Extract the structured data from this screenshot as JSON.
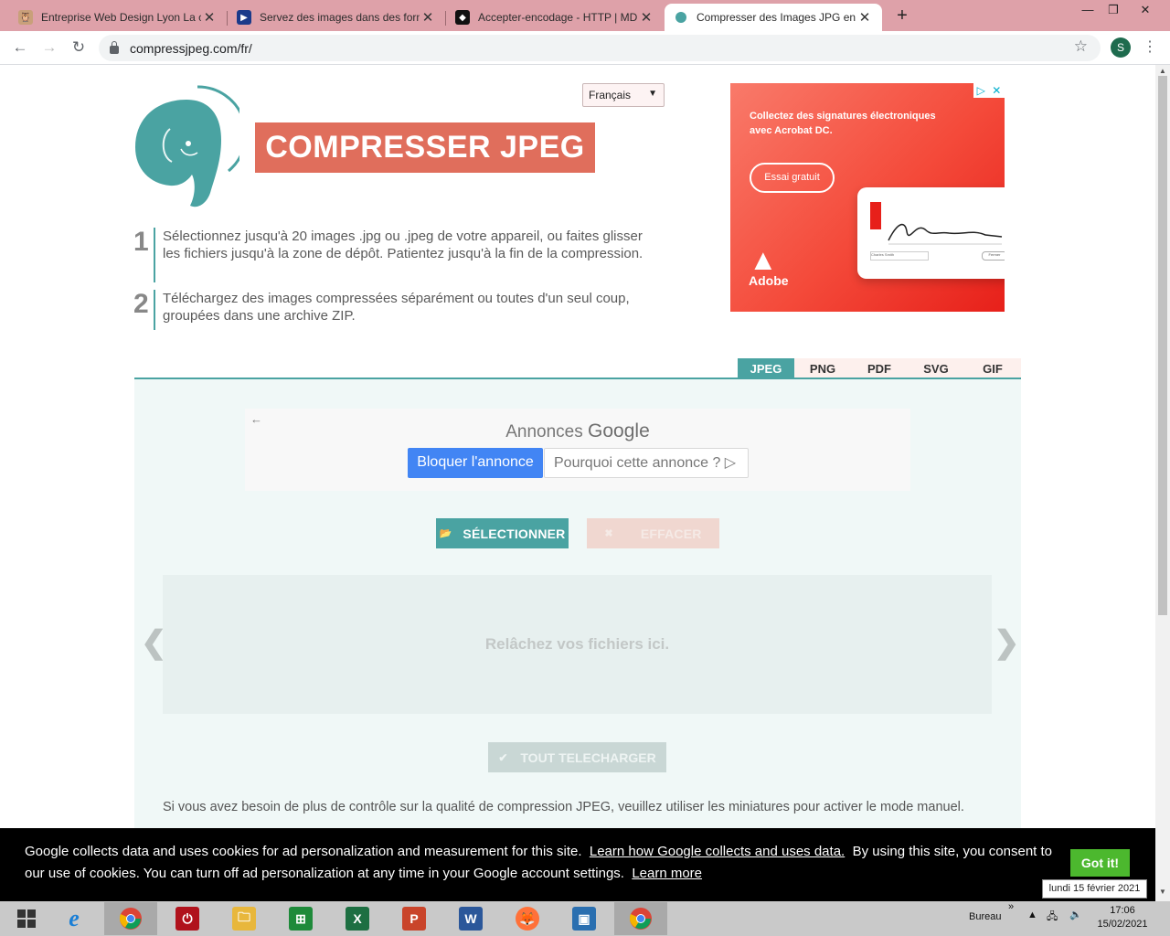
{
  "browser": {
    "tabs": [
      {
        "title": "Entreprise Web Design Lyon La c",
        "favicon": "owl-icon",
        "color": "#c9a07a"
      },
      {
        "title": "Servez des images dans des form",
        "favicon": "devtools-icon",
        "color": "#1a3a8a"
      },
      {
        "title": "Accepter-encodage - HTTP | MDI",
        "favicon": "mdn-icon",
        "color": "#111111"
      },
      {
        "title": "Compresser des Images JPG en li",
        "favicon": "elephant-icon",
        "color": "#4aa3a2"
      }
    ],
    "url": "compressjpeg.com/fr/",
    "profile_initial": "S"
  },
  "page": {
    "language": "Français",
    "brand": "COMPRESSER JPEG",
    "steps": [
      {
        "num": "1",
        "text": "Sélectionnez jusqu'à 20 images .jpg ou .jpeg de votre appareil, ou faites glisser les fichiers jusqu'à la zone de dépôt. Patientez jusqu'à la fin de la compression."
      },
      {
        "num": "2",
        "text": "Téléchargez des images compressées séparément ou toutes d'un seul coup, groupées dans une archive ZIP."
      }
    ],
    "format_tabs": [
      "JPEG",
      "PNG",
      "PDF",
      "SVG",
      "GIF"
    ],
    "active_format": "JPEG",
    "select_label": "SÉLECTIONNER",
    "clear_label": "EFFACER",
    "drop_label": "Relâchez vos fichiers ici.",
    "download_all_label": "TOUT TELECHARGER",
    "manual_note": "Si vous avez besoin de plus de contrôle sur la qualité de compression JPEG, veuillez utiliser les miniatures pour activer le mode manuel."
  },
  "ad_adobe": {
    "text": "Collectez des signatures électroniques avec Acrobat DC.",
    "cta": "Essai gratuit",
    "brand": "Adobe",
    "field_name": "Charles Smith",
    "field_button": "Fermer"
  },
  "google_ad": {
    "annonces": "Annonces",
    "google": "Google",
    "block": "Bloquer l'annonce",
    "why": "Pourquoi cette annonce ? ▷"
  },
  "cookie": {
    "text_a": "Google collects data and uses cookies for ad personalization and measurement for this site.",
    "link_a": "Learn how Google collects and uses data.",
    "text_b": "By using this site, you consent to our use of cookies. You can turn off ad personalization at any time in your Google account settings.",
    "link_b": "Learn more",
    "accept": "Got it!"
  },
  "taskbar": {
    "tooltip": "lundi 15 février 2021",
    "desktop_label": "Bureau",
    "time": "17:06",
    "date": "15/02/2021"
  }
}
